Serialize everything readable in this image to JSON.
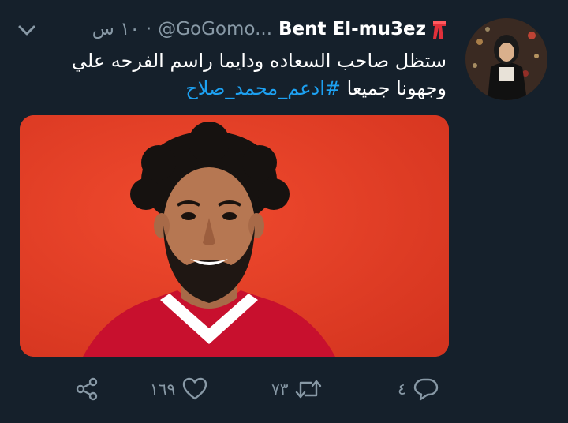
{
  "tweet": {
    "display_name": "Bent El-mu3ez",
    "handle": "@GoGomo...",
    "separator": "·",
    "time": "١٠ س",
    "text_line1": "ستظل  صاحب السعاده  ودايما راسم الفرحه علي",
    "text_line2_prefix": "وجهونا  جميعا  ",
    "hashtag": "#ادعم_محمد_صلاح",
    "scarf_icon": "red-scarf-emoji",
    "caret_icon": "chevron-down-icon"
  },
  "actions": {
    "reply_count": "٤",
    "retweet_count": "٧٣",
    "like_count": "١٦٩",
    "icons": [
      "share-icon",
      "like-icon",
      "retweet-icon",
      "reply-icon"
    ]
  },
  "colors": {
    "background": "#15202b",
    "muted": "#8899a6",
    "link": "#1da1f2",
    "media_bg": "#e8402a"
  }
}
